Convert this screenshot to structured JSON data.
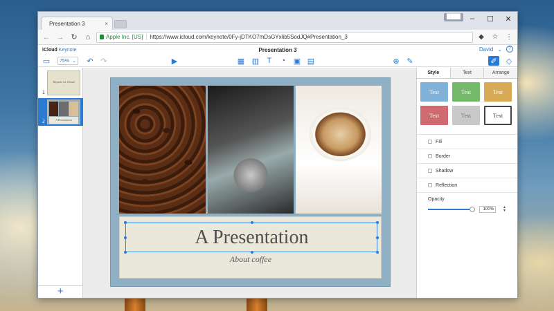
{
  "browser": {
    "tab_title": "Presentation 3",
    "tab_close": "×",
    "user_badge": "████",
    "win_minimize": "–",
    "win_maximize": "☐",
    "win_close": "✕",
    "nav_back": "←",
    "nav_forward": "→",
    "nav_reload": "↻",
    "nav_home": "⌂",
    "site_identity": "Apple Inc. [US]",
    "url": "https://www.icloud.com/keynote/0Fy-jDTKO7mDsGYxlib5SodJQ#Presentation_3",
    "extensions_glyph": "◆",
    "bookmark_glyph": "☆",
    "menu_glyph": "⋮"
  },
  "app": {
    "brand_icloud": "iCloud",
    "brand_keynote": "Keynote",
    "document_title": "Presentation 3",
    "user_name": "David",
    "user_chevron": "⌄",
    "help_glyph": "?"
  },
  "toolbar": {
    "view_glyph": "▭",
    "zoom_value": "75%",
    "zoom_chevron": "⌄",
    "undo_glyph": "↶",
    "redo_glyph": "↷",
    "play_glyph": "▶",
    "table_glyph": "▦",
    "chart_glyph": "▥",
    "text_glyph": "T",
    "shape_glyph": "◔",
    "media_glyph": "▣",
    "comment_glyph": "▤",
    "collaborate_glyph": "⊕",
    "tools_glyph": "✎",
    "format_glyph": "✐",
    "animate_glyph": "◇"
  },
  "navigator": {
    "slides": [
      {
        "number": "1",
        "title": "Keynote for iCloud",
        "subtitle": "..."
      },
      {
        "number": "2",
        "title": "A Presentation"
      }
    ],
    "add_slide": "+"
  },
  "slide": {
    "title": "A Presentation",
    "subtitle": "About coffee"
  },
  "inspector": {
    "tabs": [
      "Style",
      "Text",
      "Arrange"
    ],
    "styles": [
      {
        "label": "Text",
        "color": "#7fb1d9",
        "text_color": "#ffffff"
      },
      {
        "label": "Text",
        "color": "#74b86a",
        "text_color": "#ffffff"
      },
      {
        "label": "Text",
        "color": "#d9aa55",
        "text_color": "#ffffff"
      },
      {
        "label": "Text",
        "color": "#cf6b70",
        "text_color": "#ffffff"
      },
      {
        "label": "Text",
        "color": "#c9c9c9",
        "text_color": "#6a6a6a"
      },
      {
        "label": "Text",
        "color": "#ffffff",
        "text_color": "#444444"
      }
    ],
    "fill_label": "Fill",
    "border_label": "Border",
    "shadow_label": "Shadow",
    "reflection_label": "Reflection",
    "opacity_label": "Opacity",
    "opacity_value": "100%",
    "opacity_level": 1.0,
    "stepper_up": "▲",
    "stepper_down": "▼"
  }
}
